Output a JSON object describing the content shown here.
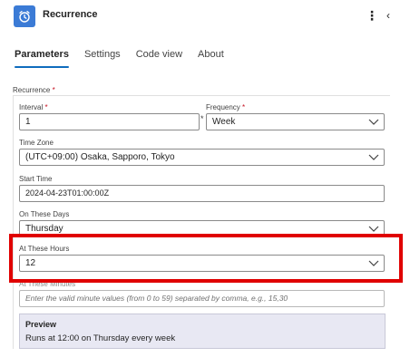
{
  "header": {
    "title": "Recurrence",
    "more_icon": "⋮",
    "collapse_icon": "‹"
  },
  "tabs": [
    {
      "label": "Parameters",
      "active": true
    },
    {
      "label": "Settings",
      "active": false
    },
    {
      "label": "Code view",
      "active": false
    },
    {
      "label": "About",
      "active": false
    }
  ],
  "recurrence": {
    "label": "Recurrence",
    "required_mark": "*",
    "interval": {
      "label": "Interval",
      "required_mark": "*",
      "value": "1"
    },
    "between_mark": "*",
    "frequency": {
      "label": "Frequency",
      "required_mark": "*",
      "value": "Week"
    },
    "time_zone": {
      "label": "Time Zone",
      "value": "(UTC+09:00) Osaka, Sapporo, Tokyo"
    },
    "start_time": {
      "label": "Start Time",
      "value": "2024-04-23T01:00:00Z"
    },
    "on_these_days": {
      "label": "On These Days",
      "value": "Thursday"
    },
    "at_these_hours": {
      "label": "At These Hours",
      "value": "12"
    },
    "at_these_minutes": {
      "label": "At These Minutes",
      "placeholder": "Enter the valid minute values (from 0 to 59) separated by comma, e.g., 15,30"
    }
  },
  "preview": {
    "title": "Preview",
    "text": "Runs at 12:00 on Thursday every week"
  },
  "colors": {
    "accent": "#0f6cbd",
    "icon_bg": "#3b7bd6",
    "highlight": "#e00000",
    "preview_bg": "#e8e8f3"
  },
  "icons": {
    "app": "alarm-clock-icon",
    "more": "more-vertical-icon",
    "collapse": "chevron-left-icon",
    "dropdown": "chevron-down-icon"
  }
}
